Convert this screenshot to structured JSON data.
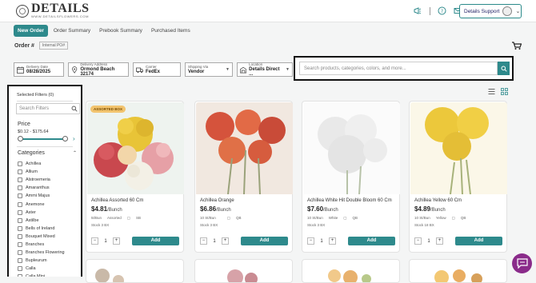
{
  "header": {
    "logo_name": "DETAILS",
    "logo_url": "WWW.DETAILSFLOWERS.COM",
    "support_label": "Details Support"
  },
  "tabs": [
    {
      "label": "New Order",
      "active": true
    },
    {
      "label": "Order Summary"
    },
    {
      "label": "Prebook Summary"
    },
    {
      "label": "Purchased Items"
    }
  ],
  "order": {
    "label": "Order #",
    "po_placeholder": "Internal PO#"
  },
  "filters": {
    "delivery_date": {
      "label": "Delivery Date",
      "value": "08/28/2025"
    },
    "delivery_address": {
      "label": "Delivery Address",
      "value": "Ormond Beach 32174"
    },
    "carrier": {
      "label": "Carrier",
      "value": "FedEx"
    },
    "shipping_via": {
      "label": "Shipping Via",
      "value": "Vendor"
    },
    "location": {
      "label": "Location",
      "value": "Details Direct ..."
    }
  },
  "search": {
    "placeholder": "Search products, categories, colors, and more..."
  },
  "sidebar": {
    "selected_filters": "Selected Filters (0)",
    "search_placeholder": "Search Filters",
    "price_label": "Price",
    "price_range": "$0.12 - $175.64",
    "categories_label": "Categories",
    "categories": [
      "Achillea",
      "Allium",
      "Alstroemeria",
      "Amaranthus",
      "Ammi Majus",
      "Anemone",
      "Aster",
      "Astilbe",
      "Bells of Ireland",
      "Bouquet Mixed",
      "Branches",
      "Branches Flowering",
      "Bupleurum",
      "Calla",
      "Calla Mini"
    ]
  },
  "products": [
    {
      "name": "Achillea Assorted 60 Cm",
      "price": "$4.81",
      "unit": "/Bunch",
      "stems": "5t/Bun",
      "color": "Assorted",
      "pack": "SB",
      "stock": "Stock 3 BX",
      "qty": "1",
      "badge": "ASSORTED BOX",
      "add": "Add"
    },
    {
      "name": "Achillea Orange",
      "price": "$6.86",
      "unit": "/Bunch",
      "stems": "10 St/Bun",
      "color": "",
      "pack": "QB",
      "stock": "Stock 3 BX",
      "qty": "1",
      "badge": "",
      "add": "Add"
    },
    {
      "name": "Achillea White Hit Double Bloom 60 Cm",
      "price": "$7.60",
      "unit": "/Bunch",
      "stems": "10 St/Bun",
      "color": "White",
      "pack": "QB",
      "stock": "Stock 3 BX",
      "qty": "1",
      "badge": "",
      "add": "Add"
    },
    {
      "name": "Achillea Yellow 60 Cm",
      "price": "$4.89",
      "unit": "/Bunch",
      "stems": "10 St/Bun",
      "color": "Yellow",
      "pack": "QB",
      "stock": "Stock 18 BX",
      "qty": "1",
      "badge": "",
      "add": "Add"
    }
  ],
  "colors": {
    "accent": "#2e8a8c",
    "chat": "#8a2b8a",
    "badge": "#f2c46f"
  }
}
